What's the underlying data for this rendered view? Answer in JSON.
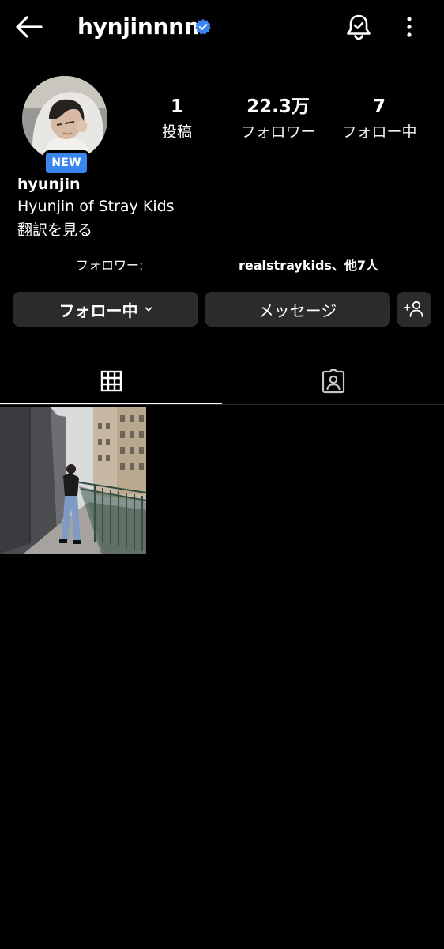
{
  "header": {
    "username": "hynjinnnn",
    "icons": {
      "back": "arrow-left-icon",
      "verified": "verified-badge-icon",
      "notifications": "bell-check-icon",
      "more": "more-vertical-icon"
    }
  },
  "profile": {
    "new_badge": "NEW",
    "stats": {
      "posts": {
        "value": "1",
        "label": "投稿"
      },
      "followers": {
        "value": "22.3万",
        "label": "フォロワー"
      },
      "following": {
        "value": "7",
        "label": "フォロー中"
      }
    },
    "display_name": "hyunjin",
    "bio": "Hyunjin of Stray Kids",
    "translate_link": "翻訳を見る",
    "followed_by": {
      "prefix": "フォロワー:",
      "account": "realstraykids、他7人"
    }
  },
  "actions": {
    "follow_label": "フォロー中",
    "message_label": "メッセージ"
  },
  "tabs": [
    {
      "name": "posts",
      "icon": "grid-icon",
      "active": true
    },
    {
      "name": "tagged",
      "icon": "tagged-person-icon",
      "active": false
    }
  ],
  "colors": {
    "background": "#000000",
    "button": "#2b2b2d",
    "verified": "#3a86f0",
    "new_badge": "#3a86f0"
  }
}
